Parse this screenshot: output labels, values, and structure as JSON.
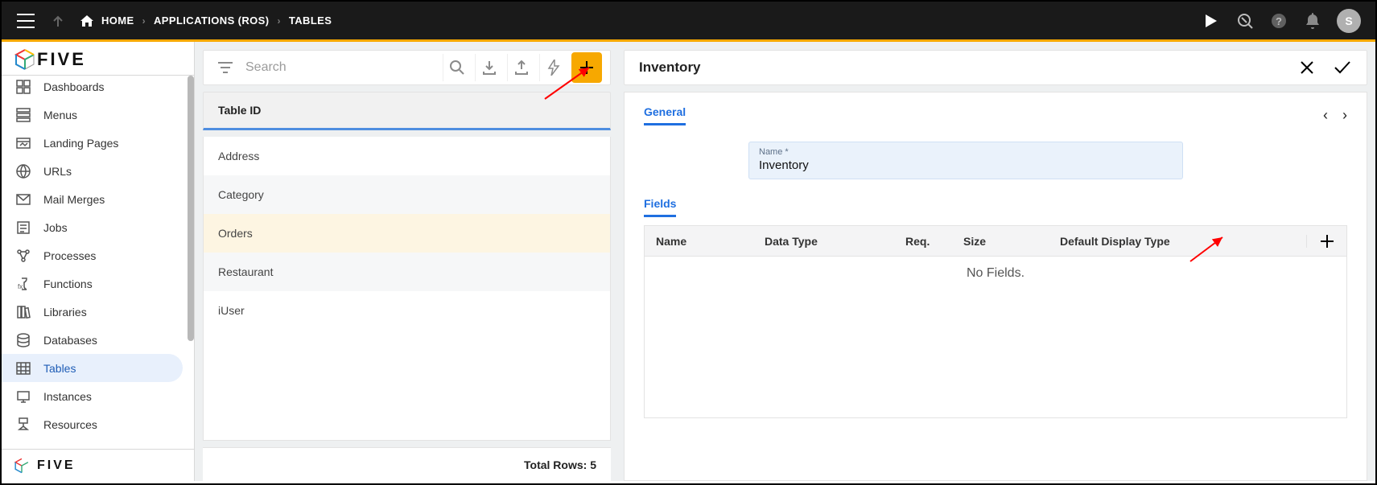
{
  "breadcrumb": {
    "home": "HOME",
    "app": "APPLICATIONS (ROS)",
    "page": "TABLES"
  },
  "avatar": "S",
  "sidebar": {
    "items": [
      {
        "label": "Dashboards",
        "icon": "dashboard"
      },
      {
        "label": "Menus",
        "icon": "menu"
      },
      {
        "label": "Landing Pages",
        "icon": "landing"
      },
      {
        "label": "URLs",
        "icon": "url"
      },
      {
        "label": "Mail Merges",
        "icon": "mail"
      },
      {
        "label": "Jobs",
        "icon": "job"
      },
      {
        "label": "Processes",
        "icon": "process"
      },
      {
        "label": "Functions",
        "icon": "function"
      },
      {
        "label": "Libraries",
        "icon": "library"
      },
      {
        "label": "Databases",
        "icon": "database"
      },
      {
        "label": "Tables",
        "icon": "table",
        "selected": true
      },
      {
        "label": "Instances",
        "icon": "instance"
      },
      {
        "label": "Resources",
        "icon": "resource"
      }
    ]
  },
  "search": {
    "placeholder": "Search"
  },
  "list": {
    "header": "Table ID",
    "rows": [
      "Address",
      "Category",
      "Orders",
      "Restaurant",
      "iUser"
    ],
    "selected_index": 2,
    "footer_label": "Total Rows:",
    "footer_count": "5"
  },
  "detail": {
    "title": "Inventory",
    "tab": "General",
    "name_label": "Name *",
    "name_value": "Inventory",
    "fields_label": "Fields",
    "columns": {
      "name": "Name",
      "type": "Data Type",
      "req": "Req.",
      "size": "Size",
      "disp": "Default Display Type"
    },
    "empty_msg": "No Fields."
  }
}
